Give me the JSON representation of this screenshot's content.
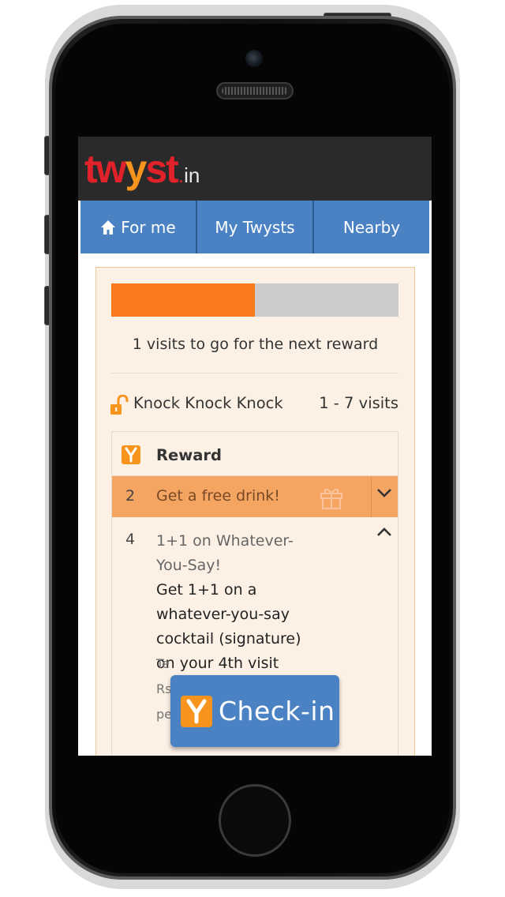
{
  "app": {
    "logo_main_a": "tw",
    "logo_main_y": "y",
    "logo_main_b": "st",
    "logo_dot": ".",
    "logo_tld": "in"
  },
  "nav": {
    "tabs": [
      {
        "label": "For me",
        "icon": "home-icon",
        "active": true
      },
      {
        "label": "My Twysts"
      },
      {
        "label": "Nearby"
      }
    ]
  },
  "progress": {
    "fraction": 0.5,
    "text": "1 visits to go for the next reward",
    "fill_color": "#fb7b1c",
    "track_color": "#cccccc"
  },
  "level": {
    "icon": "lock-open-icon",
    "name": "Knock Knock Knock",
    "range": "1 - 7 visits"
  },
  "rewards": {
    "header_label": "Reward",
    "items": [
      {
        "visit": "2",
        "title": "Get a free drink!",
        "icon": "gift-icon",
        "state": "highlighted",
        "expand_icon": "chevron-down-icon"
      },
      {
        "visit": "4",
        "title": "1+1 on Whatever-You-Say!",
        "description": "Get 1+1 on a whatever-you-say cocktail (signature) on your 4th visit",
        "terms_fragment": "Te\nRs\npe",
        "expand_icon": "chevron-up-icon"
      }
    ]
  },
  "checkin": {
    "label": "Check-in",
    "icon": "twyst-y-icon",
    "color": "#4a82c4"
  },
  "colors": {
    "brand_red": "#e2222b",
    "brand_orange": "#f7941d",
    "nav_blue": "#4a82c4",
    "card_bg": "#fdf1e6",
    "highlight_row": "#f4a562"
  }
}
